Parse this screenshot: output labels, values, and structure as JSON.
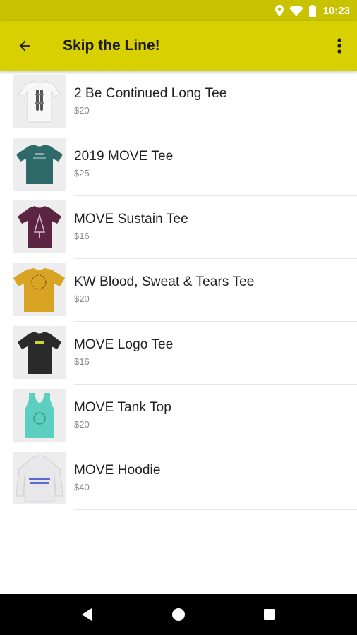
{
  "status_bar": {
    "time": "10:23",
    "icons": [
      "location-icon",
      "wifi-icon",
      "battery-icon"
    ]
  },
  "app_bar": {
    "title": "Skip the Line!",
    "back_icon": "arrow-back-icon",
    "menu_icon": "more-vert-icon",
    "color": "#d8d000"
  },
  "products": [
    {
      "name": "2 Be Continued Long Tee",
      "price": "$20",
      "shirt_color": "#f4f4f4"
    },
    {
      "name": "2019 MOVE Tee",
      "price": "$25",
      "shirt_color": "#2f6a6a"
    },
    {
      "name": "MOVE Sustain Tee",
      "price": "$16",
      "shirt_color": "#5a2442"
    },
    {
      "name": "KW Blood, Sweat & Tears Tee",
      "price": "$20",
      "shirt_color": "#d9a323"
    },
    {
      "name": "MOVE Logo Tee",
      "price": "$16",
      "shirt_color": "#2a2a2a"
    },
    {
      "name": "MOVE Tank Top",
      "price": "$20",
      "shirt_color": "#5ccfc0"
    },
    {
      "name": "MOVE Hoodie",
      "price": "$40",
      "shirt_color": "#e8e8ea"
    }
  ],
  "nav_bar": {
    "icons": [
      "back-triangle-icon",
      "home-circle-icon",
      "recents-square-icon"
    ]
  }
}
